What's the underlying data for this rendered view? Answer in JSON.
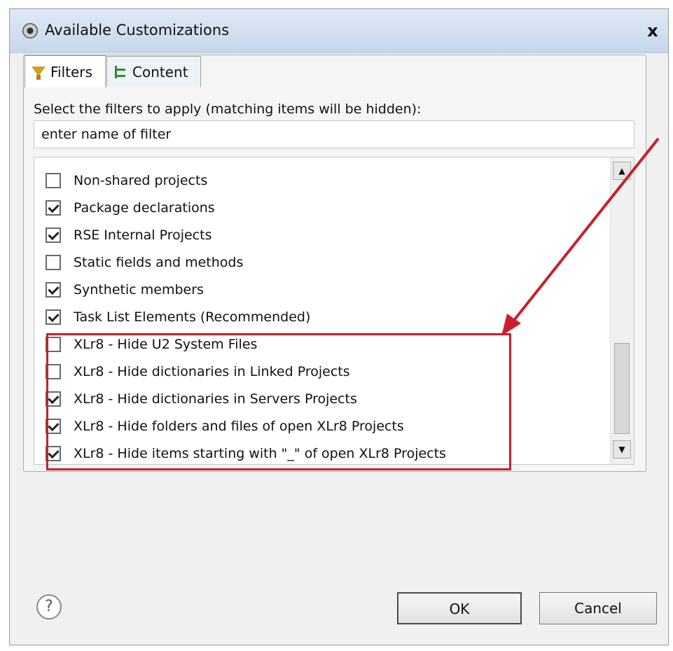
{
  "window": {
    "title": "Available Customizations",
    "close_label": "x"
  },
  "tabs": [
    {
      "label": "Filters",
      "icon": "filter-icon",
      "selected": true
    },
    {
      "label": "Content",
      "icon": "content-icon",
      "selected": false
    }
  ],
  "instruction": "Select the filters to apply (matching items will be hidden):",
  "filter_input": {
    "value": "enter name of filter"
  },
  "filters": [
    {
      "label": "Non-shared projects",
      "checked": false
    },
    {
      "label": "Package declarations",
      "checked": true
    },
    {
      "label": "RSE Internal Projects",
      "checked": true
    },
    {
      "label": "Static fields and methods",
      "checked": false
    },
    {
      "label": "Synthetic members",
      "checked": true
    },
    {
      "label": "Task List Elements (Recommended)",
      "checked": true
    },
    {
      "label": "XLr8 - Hide U2 System Files",
      "checked": false
    },
    {
      "label": "XLr8 - Hide dictionaries in Linked Projects",
      "checked": false
    },
    {
      "label": "XLr8 - Hide dictionaries in Servers Projects",
      "checked": true
    },
    {
      "label": "XLr8 - Hide folders and files of open XLr8 Projects",
      "checked": true
    },
    {
      "label": "XLr8 - Hide items starting with \"_\" of open XLr8 Projects",
      "checked": true
    }
  ],
  "buttons": {
    "ok": "OK",
    "cancel": "Cancel",
    "help": "?"
  },
  "colors": {
    "highlight": "#c8202e",
    "titlebar": "#c6d7ec"
  }
}
